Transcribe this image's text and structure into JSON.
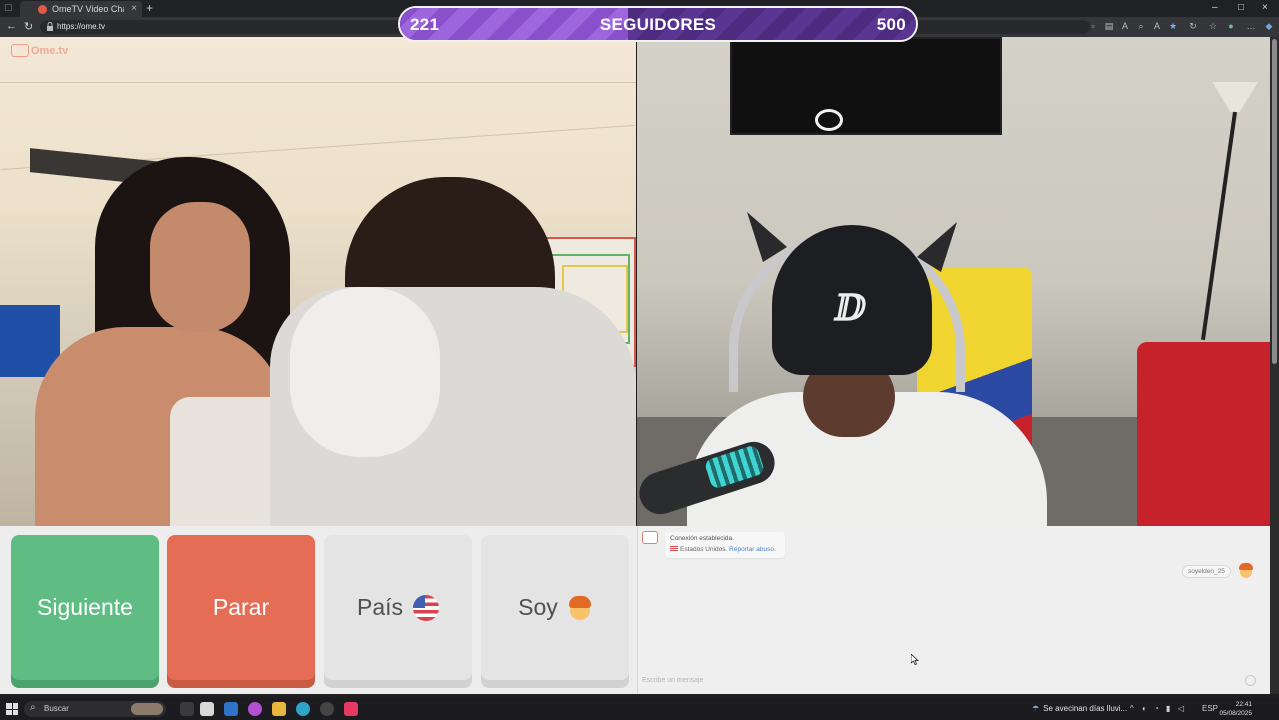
{
  "browser": {
    "tab_title": "OmeTV Video Chat — Ome",
    "url": "https://ome.tv",
    "new_tab": "+",
    "tab_close": "×",
    "window_controls": [
      "–",
      "□",
      "×"
    ],
    "nav_buttons": [
      "←",
      "↻"
    ]
  },
  "followers": {
    "current": "221",
    "label": "SEGUIDORES",
    "goal": "500",
    "progress_fraction": 0.442,
    "fill_color": "#9e66dc"
  },
  "video": {
    "watermark": "Ome.tv"
  },
  "controls": {
    "next_label": "Siguiente",
    "stop_label": "Parar",
    "country_label": "País",
    "country_icon": "us-flag-icon",
    "gender_label": "Soy",
    "gender_icon": "boy-icon",
    "colors": {
      "next": "#5fbc82",
      "stop": "#e56d55",
      "neutral": "#e4e4e4"
    }
  },
  "chat": {
    "system_line1": "Conexión establecida.",
    "system_country": "Estados Unidos.",
    "report_link": "Reportar abuso.",
    "username": "soyelden_25",
    "input_placeholder": "Escribe un mensaje"
  },
  "taskbar": {
    "search_label": "Buscar",
    "weather_text": "Se avecinan días lluvi...",
    "language": "ESP",
    "time": "22:41",
    "date": "05/08/2025"
  }
}
